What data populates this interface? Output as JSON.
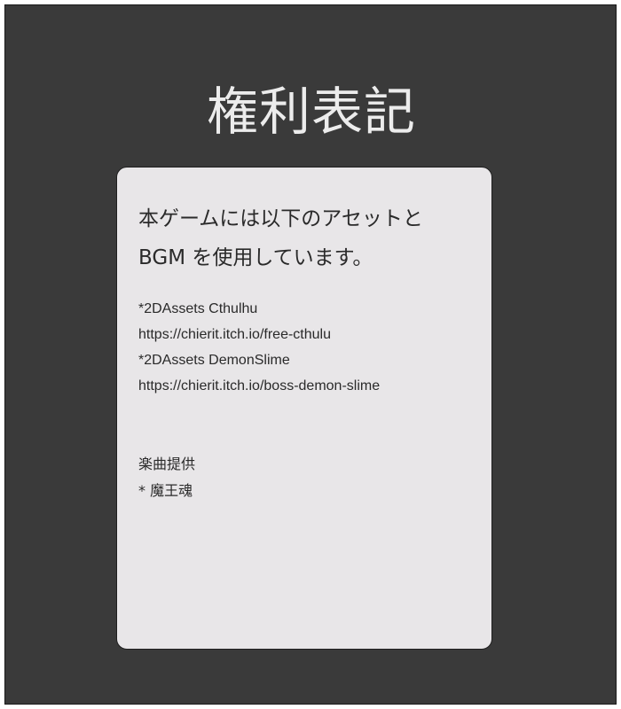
{
  "page": {
    "title": "権利表記"
  },
  "card": {
    "intro_lines": [
      "本ゲームには以下のアセットと",
      "BGM を使用しています。"
    ],
    "credits": [
      "*2DAssets Cthulhu",
      "https://chierit.itch.io/free-cthulu",
      "*2DAssets DemonSlime",
      "https://chierit.itch.io/boss-demon-slime"
    ],
    "music_heading": "楽曲提供",
    "music_credit": "* 魔王魂"
  },
  "colors": {
    "background": "#3a3a3a",
    "card": "#e8e6e8",
    "title_text": "#ececec",
    "body_text": "#2a2a2a"
  }
}
